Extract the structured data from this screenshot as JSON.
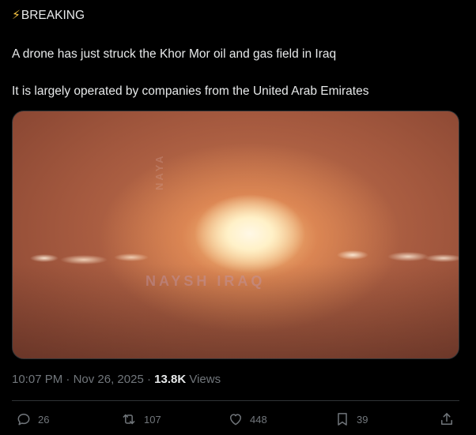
{
  "tweet": {
    "headline": "BREAKING",
    "headline_icon": "lightning-bolt-icon",
    "line1": "A drone has just struck the Khor Mor oil and gas field in Iraq",
    "line2": "It is largely operated by companies from the United Arab Emirates",
    "media": {
      "watermark": "NAYSH IRAQ",
      "watermark_vertical": "NAYA"
    },
    "time": "10:07 PM",
    "date": "Nov 26, 2025",
    "views_count": "13.8K",
    "views_label": "Views"
  },
  "actions": {
    "replies": "26",
    "reposts": "107",
    "likes": "448",
    "bookmarks": "39"
  },
  "colors": {
    "background": "#000000",
    "text": "#e7e9ea",
    "muted": "#71767b",
    "border": "#2f3336",
    "bolt": "#f6c343"
  }
}
